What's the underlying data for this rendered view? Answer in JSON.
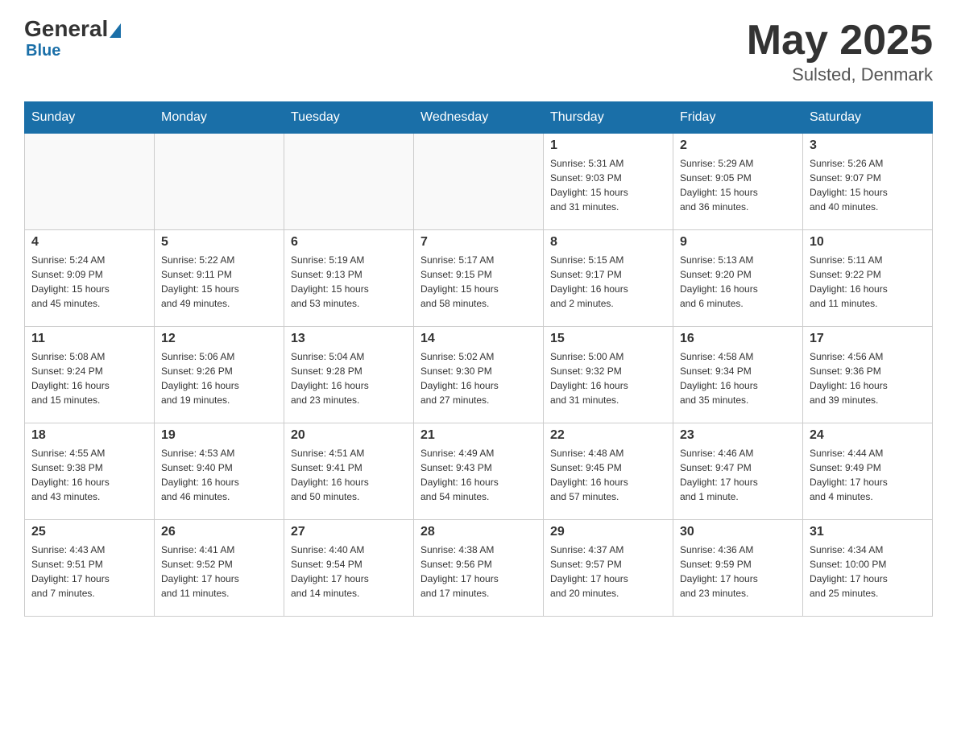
{
  "header": {
    "logo": {
      "general": "General",
      "blue": "Blue"
    },
    "title": "May 2025",
    "location": "Sulsted, Denmark"
  },
  "weekdays": [
    "Sunday",
    "Monday",
    "Tuesday",
    "Wednesday",
    "Thursday",
    "Friday",
    "Saturday"
  ],
  "weeks": [
    [
      {
        "day": "",
        "info": ""
      },
      {
        "day": "",
        "info": ""
      },
      {
        "day": "",
        "info": ""
      },
      {
        "day": "",
        "info": ""
      },
      {
        "day": "1",
        "info": "Sunrise: 5:31 AM\nSunset: 9:03 PM\nDaylight: 15 hours\nand 31 minutes."
      },
      {
        "day": "2",
        "info": "Sunrise: 5:29 AM\nSunset: 9:05 PM\nDaylight: 15 hours\nand 36 minutes."
      },
      {
        "day": "3",
        "info": "Sunrise: 5:26 AM\nSunset: 9:07 PM\nDaylight: 15 hours\nand 40 minutes."
      }
    ],
    [
      {
        "day": "4",
        "info": "Sunrise: 5:24 AM\nSunset: 9:09 PM\nDaylight: 15 hours\nand 45 minutes."
      },
      {
        "day": "5",
        "info": "Sunrise: 5:22 AM\nSunset: 9:11 PM\nDaylight: 15 hours\nand 49 minutes."
      },
      {
        "day": "6",
        "info": "Sunrise: 5:19 AM\nSunset: 9:13 PM\nDaylight: 15 hours\nand 53 minutes."
      },
      {
        "day": "7",
        "info": "Sunrise: 5:17 AM\nSunset: 9:15 PM\nDaylight: 15 hours\nand 58 minutes."
      },
      {
        "day": "8",
        "info": "Sunrise: 5:15 AM\nSunset: 9:17 PM\nDaylight: 16 hours\nand 2 minutes."
      },
      {
        "day": "9",
        "info": "Sunrise: 5:13 AM\nSunset: 9:20 PM\nDaylight: 16 hours\nand 6 minutes."
      },
      {
        "day": "10",
        "info": "Sunrise: 5:11 AM\nSunset: 9:22 PM\nDaylight: 16 hours\nand 11 minutes."
      }
    ],
    [
      {
        "day": "11",
        "info": "Sunrise: 5:08 AM\nSunset: 9:24 PM\nDaylight: 16 hours\nand 15 minutes."
      },
      {
        "day": "12",
        "info": "Sunrise: 5:06 AM\nSunset: 9:26 PM\nDaylight: 16 hours\nand 19 minutes."
      },
      {
        "day": "13",
        "info": "Sunrise: 5:04 AM\nSunset: 9:28 PM\nDaylight: 16 hours\nand 23 minutes."
      },
      {
        "day": "14",
        "info": "Sunrise: 5:02 AM\nSunset: 9:30 PM\nDaylight: 16 hours\nand 27 minutes."
      },
      {
        "day": "15",
        "info": "Sunrise: 5:00 AM\nSunset: 9:32 PM\nDaylight: 16 hours\nand 31 minutes."
      },
      {
        "day": "16",
        "info": "Sunrise: 4:58 AM\nSunset: 9:34 PM\nDaylight: 16 hours\nand 35 minutes."
      },
      {
        "day": "17",
        "info": "Sunrise: 4:56 AM\nSunset: 9:36 PM\nDaylight: 16 hours\nand 39 minutes."
      }
    ],
    [
      {
        "day": "18",
        "info": "Sunrise: 4:55 AM\nSunset: 9:38 PM\nDaylight: 16 hours\nand 43 minutes."
      },
      {
        "day": "19",
        "info": "Sunrise: 4:53 AM\nSunset: 9:40 PM\nDaylight: 16 hours\nand 46 minutes."
      },
      {
        "day": "20",
        "info": "Sunrise: 4:51 AM\nSunset: 9:41 PM\nDaylight: 16 hours\nand 50 minutes."
      },
      {
        "day": "21",
        "info": "Sunrise: 4:49 AM\nSunset: 9:43 PM\nDaylight: 16 hours\nand 54 minutes."
      },
      {
        "day": "22",
        "info": "Sunrise: 4:48 AM\nSunset: 9:45 PM\nDaylight: 16 hours\nand 57 minutes."
      },
      {
        "day": "23",
        "info": "Sunrise: 4:46 AM\nSunset: 9:47 PM\nDaylight: 17 hours\nand 1 minute."
      },
      {
        "day": "24",
        "info": "Sunrise: 4:44 AM\nSunset: 9:49 PM\nDaylight: 17 hours\nand 4 minutes."
      }
    ],
    [
      {
        "day": "25",
        "info": "Sunrise: 4:43 AM\nSunset: 9:51 PM\nDaylight: 17 hours\nand 7 minutes."
      },
      {
        "day": "26",
        "info": "Sunrise: 4:41 AM\nSunset: 9:52 PM\nDaylight: 17 hours\nand 11 minutes."
      },
      {
        "day": "27",
        "info": "Sunrise: 4:40 AM\nSunset: 9:54 PM\nDaylight: 17 hours\nand 14 minutes."
      },
      {
        "day": "28",
        "info": "Sunrise: 4:38 AM\nSunset: 9:56 PM\nDaylight: 17 hours\nand 17 minutes."
      },
      {
        "day": "29",
        "info": "Sunrise: 4:37 AM\nSunset: 9:57 PM\nDaylight: 17 hours\nand 20 minutes."
      },
      {
        "day": "30",
        "info": "Sunrise: 4:36 AM\nSunset: 9:59 PM\nDaylight: 17 hours\nand 23 minutes."
      },
      {
        "day": "31",
        "info": "Sunrise: 4:34 AM\nSunset: 10:00 PM\nDaylight: 17 hours\nand 25 minutes."
      }
    ]
  ]
}
